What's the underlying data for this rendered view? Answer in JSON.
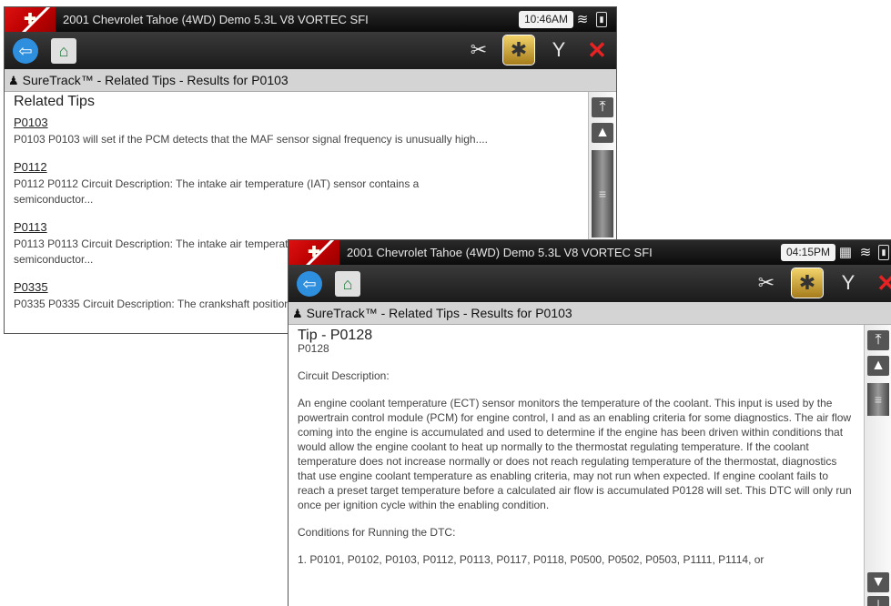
{
  "window1": {
    "title": "2001 Chevrolet Tahoe (4WD) Demo 5.3L V8 VORTEC SFI",
    "clock": "10:46AM",
    "breadcrumb": "SureTrack™ - Related Tips - Results for P0103",
    "heading": "Related Tips",
    "tips": [
      {
        "code": "P0103",
        "summary": "P0103 P0103 will set if the PCM detects that the MAF sensor signal frequency is unusually high...."
      },
      {
        "code": "P0112",
        "summary": "P0112 P0112 Circuit Description: The intake air temperature (IAT) sensor contains a semiconductor..."
      },
      {
        "code": "P0113",
        "summary": "P0113 P0113 Circuit Description: The intake air temperature (IAT) sensor contains a semiconductor..."
      },
      {
        "code": "P0335",
        "summary": "P0335 P0335 Circuit Description: The crankshaft position (CKP) sensor..."
      }
    ]
  },
  "window2": {
    "title": "2001 Chevrolet Tahoe (4WD) Demo 5.3L V8 VORTEC SFI",
    "clock": "04:15PM",
    "breadcrumb": "SureTrack™ - Related Tips - Results for P0103",
    "tip_title": "Tip - P0128",
    "tip_code": "P0128",
    "section1": "Circuit Description:",
    "body": "An engine coolant temperature (ECT) sensor monitors the temperature of the coolant. This input is used by the powertrain control module (PCM) for engine control, I and as an enabling criteria for some diagnostics.  The air flow coming into the engine is accumulated and used to determine if the engine has been driven within conditions that would allow the engine coolant to heat up normally to the thermostat regulating temperature. If the coolant temperature does not increase normally or does not reach regulating temperature of the thermostat, diagnostics that use engine coolant temperature as enabling criteria, may not run when expected.  If engine coolant fails to reach a preset target temperature before a calculated air flow is accumulated P0128 will set.  This DTC will only run once per ignition cycle within the enabling condition.",
    "section2": "Conditions for Running the DTC:",
    "condition1": "1.  P0101, P0102, P0103, P0112, P0113, P0117, P0118, P0500, P0502, P0503, P1111, P1114, or"
  },
  "icons": {
    "logo": "scanner-logo-icon",
    "back": "back-arrow-icon",
    "home": "home-icon",
    "tool1": "wrench-screwdriver-icon",
    "tool2": "gear-tools-icon",
    "tool3": "wrench-icon",
    "exit": "exit-x-icon"
  },
  "colors": {
    "accent": "#2f8fdf",
    "active_tool": "#d9b13c",
    "exit": "#e62222"
  }
}
